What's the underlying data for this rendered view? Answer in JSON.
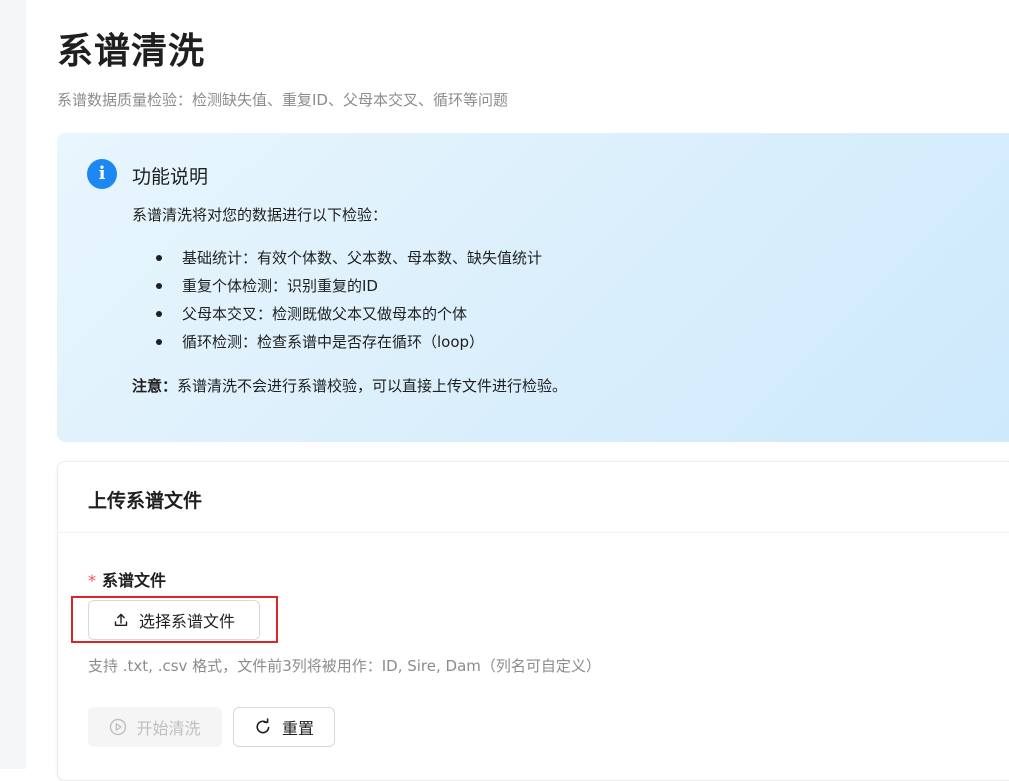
{
  "page": {
    "title": "系谱清洗",
    "subtitle": "系谱数据质量检验：检测缺失值、重复ID、父母本交叉、循环等问题"
  },
  "info": {
    "icon": "info-icon",
    "icon_glyph": "i",
    "title": "功能说明",
    "intro": "系谱清洗将对您的数据进行以下检验：",
    "items": [
      "基础统计：有效个体数、父本数、母本数、缺失值统计",
      "重复个体检测：识别重复的ID",
      "父母本交叉：检测既做父本又做母本的个体",
      "循环检测：检查系谱中是否存在循环（loop）"
    ],
    "note_label": "注意：",
    "note_text": "系谱清洗不会进行系谱校验，可以直接上传文件进行检验。",
    "accent_color": "#1e88f2"
  },
  "upload": {
    "card_title": "上传系谱文件",
    "required_mark": "*",
    "field_label": "系谱文件",
    "select_button_label": "选择系谱文件",
    "help_text": "支持 .txt, .csv 格式，文件前3列将被用作：ID, Sire, Dam（列名可自定义）",
    "start_button_label": "开始清洗",
    "start_button_disabled": true,
    "reset_button_label": "重置"
  }
}
